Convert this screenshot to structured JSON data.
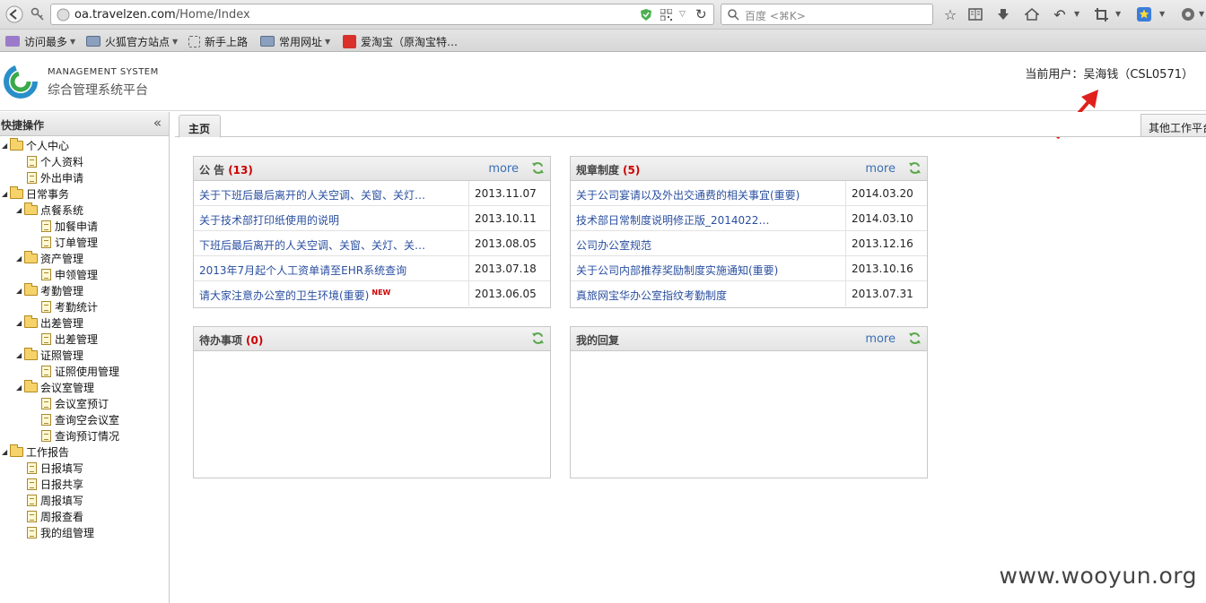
{
  "browser": {
    "url_host": "oa.travelzen.com",
    "url_path": "/Home/Index",
    "search_placeholder": "百度 <⌘K>",
    "bookmarks": [
      {
        "label": "访问最多"
      },
      {
        "label": "火狐官方站点"
      },
      {
        "label": "新手上路"
      },
      {
        "label": "常用网址"
      },
      {
        "label": "爱淘宝（原淘宝特…"
      }
    ]
  },
  "header": {
    "brand_en": "MANAGEMENT SYSTEM",
    "brand_cn": "综合管理系统平台",
    "current_user": "当前用户：吴海钱（CSL0571）"
  },
  "sidebar": {
    "title": "快捷操作",
    "collapse_glyph": "«",
    "tree": [
      {
        "label": "个人中心",
        "type": "folder"
      },
      {
        "label": "个人资料",
        "type": "doc"
      },
      {
        "label": "外出申请",
        "type": "doc"
      },
      {
        "label": "日常事务",
        "type": "folder"
      },
      {
        "label": "点餐系统",
        "type": "folder"
      },
      {
        "label": "加餐申请",
        "type": "doc"
      },
      {
        "label": "订单管理",
        "type": "doc"
      },
      {
        "label": "资产管理",
        "type": "folder"
      },
      {
        "label": "申领管理",
        "type": "doc"
      },
      {
        "label": "考勤管理",
        "type": "folder"
      },
      {
        "label": "考勤统计",
        "type": "doc"
      },
      {
        "label": "出差管理",
        "type": "folder"
      },
      {
        "label": "出差管理",
        "type": "doc"
      },
      {
        "label": "证照管理",
        "type": "folder"
      },
      {
        "label": "证照使用管理",
        "type": "doc"
      },
      {
        "label": "会议室管理",
        "type": "folder"
      },
      {
        "label": "会议室预订",
        "type": "doc"
      },
      {
        "label": "查询空会议室",
        "type": "doc"
      },
      {
        "label": "查询预订情况",
        "type": "doc"
      },
      {
        "label": "工作报告",
        "type": "folder"
      },
      {
        "label": "日报填写",
        "type": "doc"
      },
      {
        "label": "日报共享",
        "type": "doc"
      },
      {
        "label": "周报填写",
        "type": "doc"
      },
      {
        "label": "周报查看",
        "type": "doc"
      },
      {
        "label": "我的组管理",
        "type": "doc"
      }
    ]
  },
  "tabs": {
    "home": "主页",
    "other": "其他工作平台"
  },
  "panels": {
    "notice": {
      "title": "公 告",
      "count": "(13)",
      "more": "more",
      "rows": [
        {
          "title": "关于下班后最后离开的人关空调、关窗、关灯…",
          "date": "2013.11.07"
        },
        {
          "title": "关于技术部打印纸使用的说明",
          "date": "2013.10.11"
        },
        {
          "title": "下班后最后离开的人关空调、关窗、关灯、关…",
          "date": "2013.08.05"
        },
        {
          "title": "2013年7月起个人工资单请至EHR系统查询",
          "date": "2013.07.18"
        },
        {
          "title": "请大家注意办公室的卫生环境(重要)",
          "date": "2013.06.05",
          "badge": "NEW"
        }
      ]
    },
    "rules": {
      "title": "规章制度",
      "count": "(5)",
      "more": "more",
      "rows": [
        {
          "title": "关于公司宴请以及外出交通费的相关事宜(重要)",
          "date": "2014.03.20"
        },
        {
          "title": "技术部日常制度说明修正版_2014022…",
          "date": "2014.03.10"
        },
        {
          "title": "公司办公室规范",
          "date": "2013.12.16"
        },
        {
          "title": "关于公司内部推荐奖励制度实施通知(重要)",
          "date": "2013.10.16"
        },
        {
          "title": "真旅网宝华办公室指纹考勤制度",
          "date": "2013.07.31"
        }
      ]
    },
    "todo": {
      "title": "待办事项",
      "count": "(0)"
    },
    "replies": {
      "title": "我的回复",
      "more": "more"
    }
  },
  "watermark": "www.wooyun.org",
  "colors": {
    "link": "#2a4fa0",
    "count_red": "#cc0000",
    "more_blue": "#3a6fb5",
    "annotation_arrow": "#e0201c"
  }
}
